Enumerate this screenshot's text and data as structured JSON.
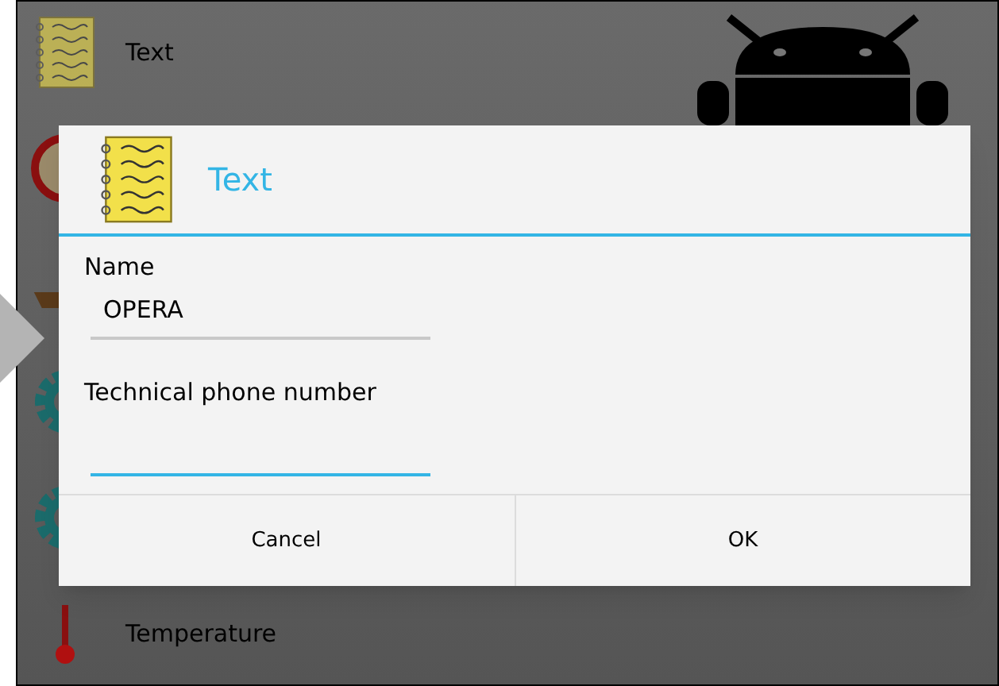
{
  "background_list": {
    "items": [
      {
        "kind": "notepad",
        "label": "Text"
      },
      {
        "kind": "clock"
      },
      {
        "kind": "scale"
      },
      {
        "kind": "gear"
      },
      {
        "kind": "gear"
      },
      {
        "kind": "thermometer",
        "label": "Temperature"
      }
    ]
  },
  "dialog": {
    "title": "Text",
    "fields": [
      {
        "label": "Name",
        "value": "OPERA",
        "focused": false
      },
      {
        "label": "Technical phone number",
        "focused": true
      }
    ],
    "buttons": [
      "Cancel",
      "OK"
    ]
  }
}
